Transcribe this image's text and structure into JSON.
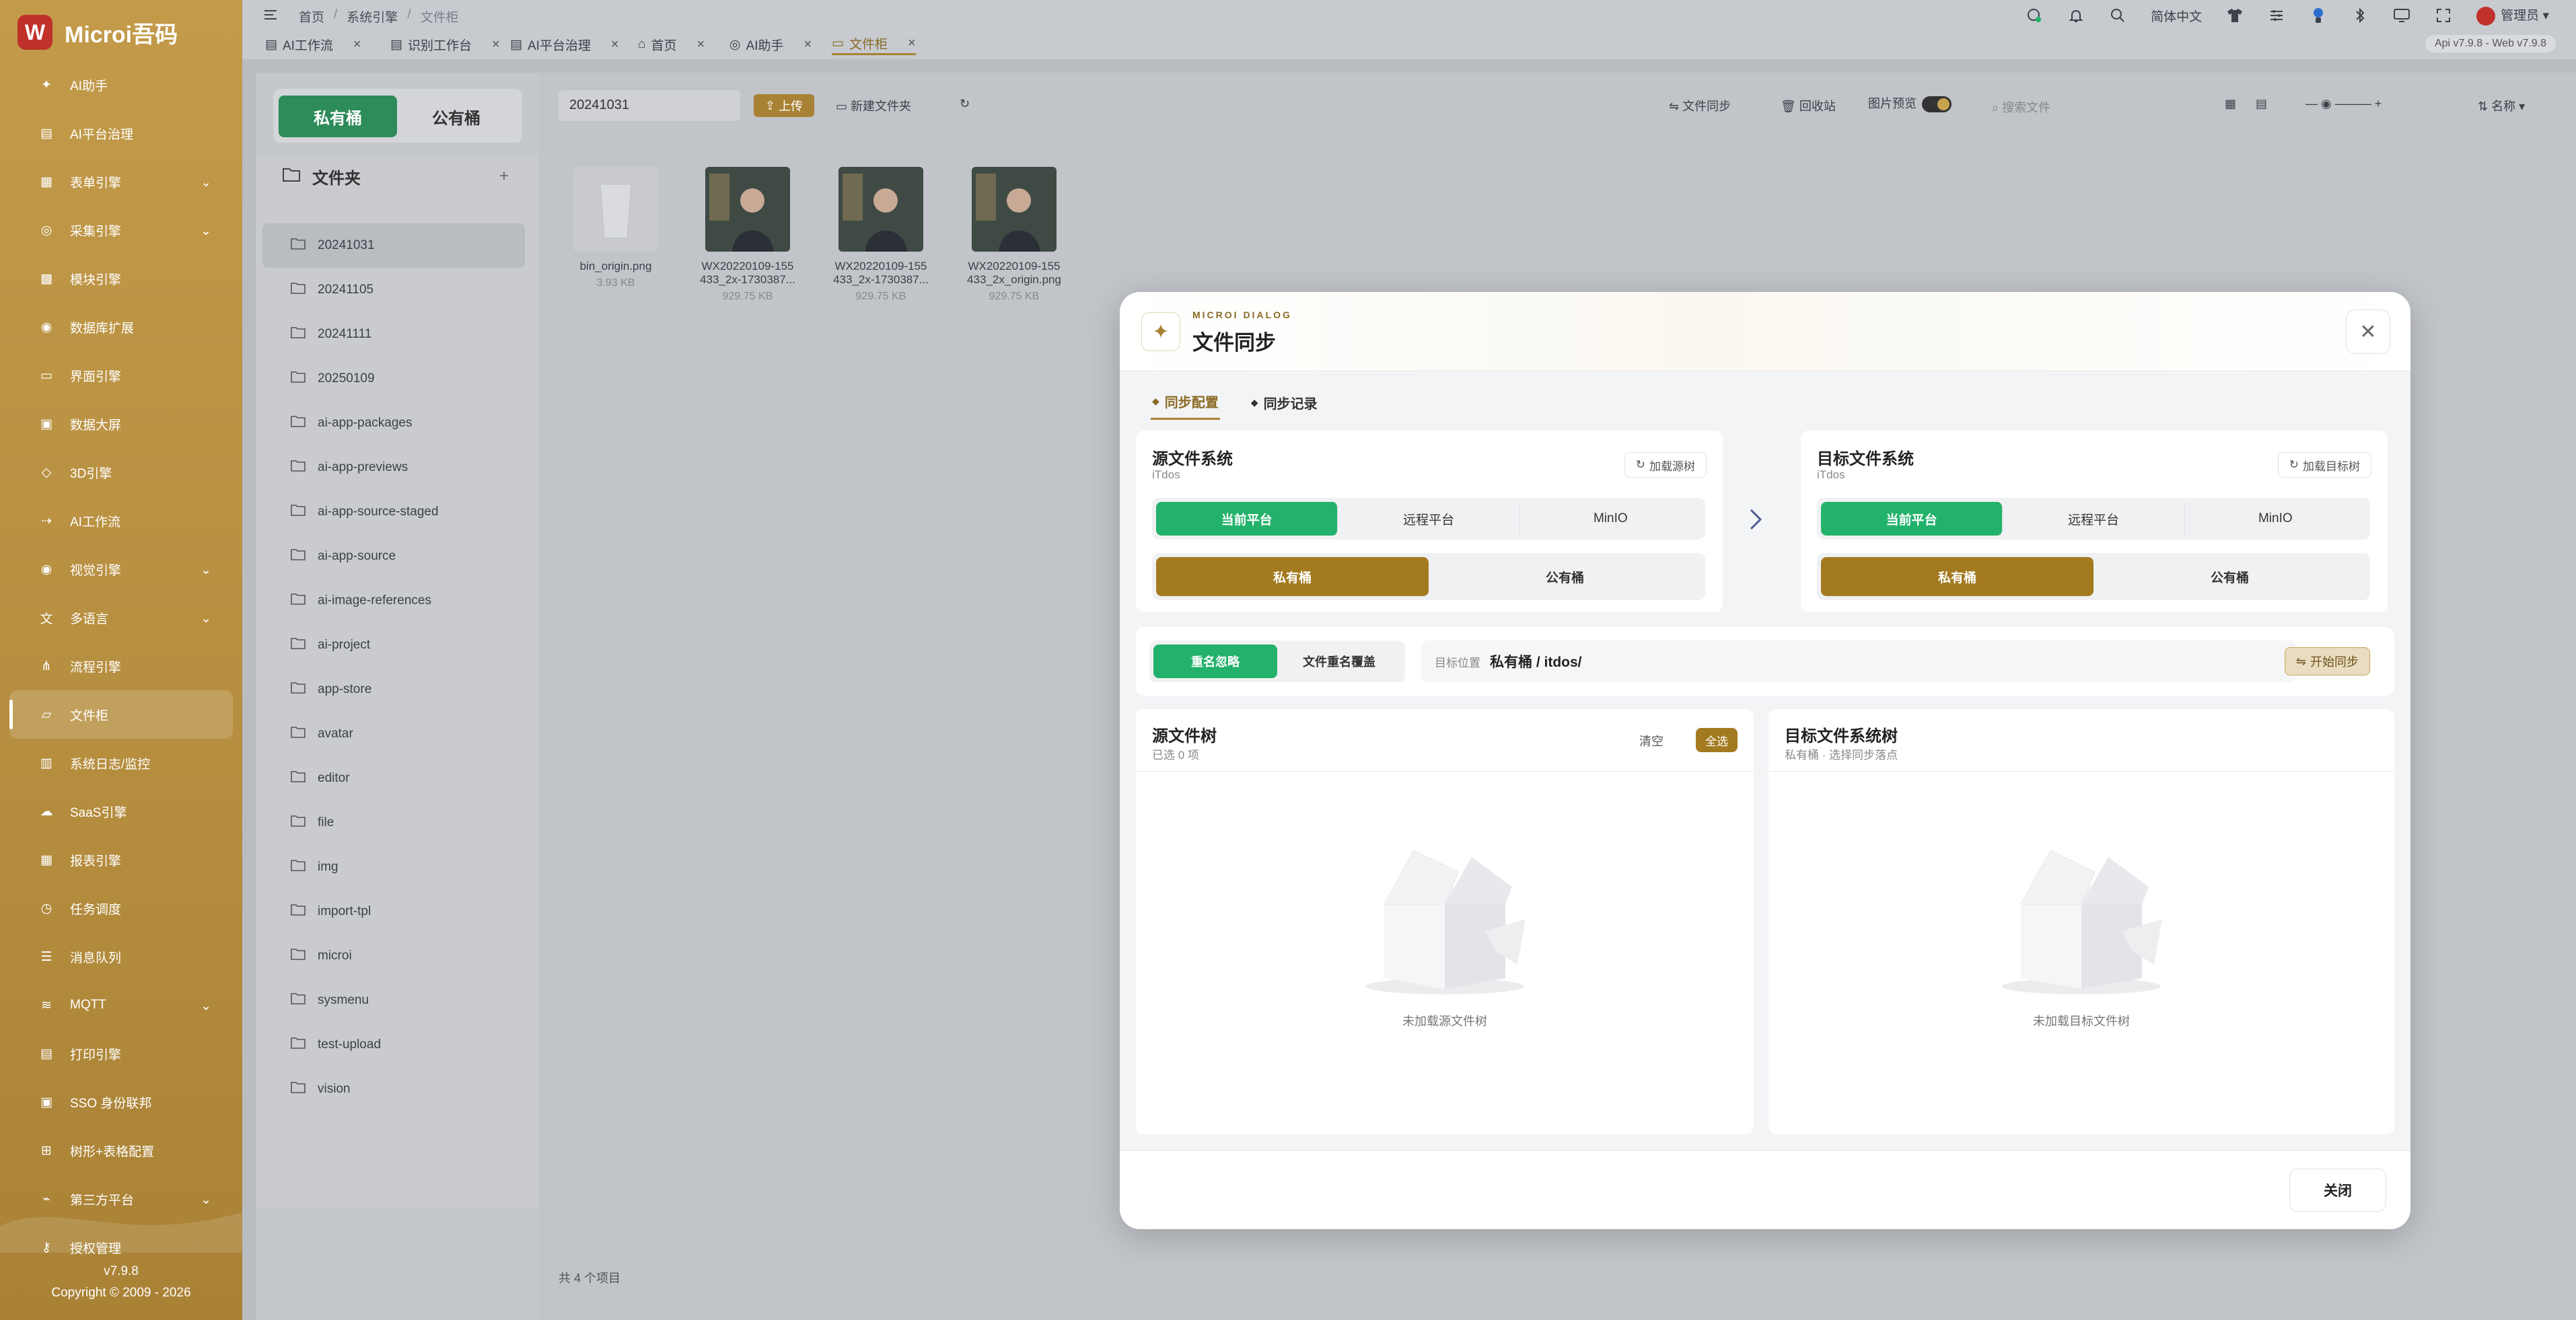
{
  "app": {
    "title": "Microi吾码",
    "logo_letter": "W"
  },
  "sidebar": {
    "items": [
      {
        "label": "AI助手",
        "icon": "sparkle-icon",
        "has_children": false
      },
      {
        "label": "AI平台治理",
        "icon": "database-icon",
        "has_children": false
      },
      {
        "label": "表单引擎",
        "icon": "form-icon",
        "has_children": true
      },
      {
        "label": "采集引擎",
        "icon": "globe-icon",
        "has_children": true
      },
      {
        "label": "模块引擎",
        "icon": "grid-icon",
        "has_children": false
      },
      {
        "label": "数据库扩展",
        "icon": "db-icon",
        "has_children": false
      },
      {
        "label": "界面引擎",
        "icon": "layout-icon",
        "has_children": false
      },
      {
        "label": "数据大屏",
        "icon": "monitor-icon",
        "has_children": false
      },
      {
        "label": "3D引擎",
        "icon": "cube-icon",
        "has_children": false
      },
      {
        "label": "AI工作流",
        "icon": "flow-icon",
        "has_children": false
      },
      {
        "label": "视觉引擎",
        "icon": "eye-icon",
        "has_children": true
      },
      {
        "label": "多语言",
        "icon": "language-icon",
        "has_children": true
      },
      {
        "label": "流程引擎",
        "icon": "share-icon",
        "has_children": false
      },
      {
        "label": "文件柜",
        "icon": "folder-icon",
        "has_children": false,
        "active": true
      },
      {
        "label": "系统日志/监控",
        "icon": "log-icon",
        "has_children": false
      },
      {
        "label": "SaaS引擎",
        "icon": "cloud-icon",
        "has_children": false
      },
      {
        "label": "报表引擎",
        "icon": "report-icon",
        "has_children": false
      },
      {
        "label": "任务调度",
        "icon": "clock-icon",
        "has_children": false
      },
      {
        "label": "消息队列",
        "icon": "queue-icon",
        "has_children": false
      },
      {
        "label": "MQTT",
        "icon": "wifi-icon",
        "has_children": true
      },
      {
        "label": "打印引擎",
        "icon": "printer-icon",
        "has_children": false
      },
      {
        "label": "SSO 身份联邦",
        "icon": "id-icon",
        "has_children": false
      },
      {
        "label": "树形+表格配置",
        "icon": "tree-icon",
        "has_children": false
      },
      {
        "label": "第三方平台",
        "icon": "plug-icon",
        "has_children": true
      },
      {
        "label": "授权管理",
        "icon": "key-icon",
        "has_children": false
      }
    ],
    "version": "v7.9.8",
    "copyright": "Copyright © 2009 - 2026"
  },
  "topbar": {
    "breadcrumb": [
      "首页",
      "系统引擎",
      "文件柜"
    ],
    "language": "简体中文",
    "user": "管理员",
    "version_badge": "Api v7.9.8 - Web v7.9.8"
  },
  "tabs": [
    {
      "label": "AI工作流",
      "active": false
    },
    {
      "label": "识别工作台",
      "active": false
    },
    {
      "label": "AI平台治理",
      "active": false
    },
    {
      "label": "首页",
      "active": false
    },
    {
      "label": "AI助手",
      "active": false
    },
    {
      "label": "文件柜",
      "active": true
    }
  ],
  "file_manager": {
    "bucket_private": "私有桶",
    "bucket_public": "公有桶",
    "folder_title": "文件夹",
    "folders": [
      "20241031",
      "20241105",
      "20241111",
      "20250109",
      "ai-app-packages",
      "ai-app-previews",
      "ai-app-source-staged",
      "ai-app-source",
      "ai-image-references",
      "ai-project",
      "app-store",
      "avatar",
      "editor",
      "file",
      "img",
      "import-tpl",
      "microi",
      "sysmenu",
      "test-upload",
      "vision"
    ],
    "selected_folder": "20241031",
    "path_value": "20241031",
    "upload": "上传",
    "new_folder": "新建文件夹",
    "file_sync": "文件同步",
    "recycle_bin": "回收站",
    "image_preview": "图片预览",
    "search_placeholder": "搜索文件",
    "sort": "名称",
    "files": [
      {
        "name1": "bin_origin.png",
        "name2": "",
        "size": "3.93 KB"
      },
      {
        "name1": "WX20220109-155",
        "name2": "433_2x-1730387...",
        "size": "929.75 KB"
      },
      {
        "name1": "WX20220109-155",
        "name2": "433_2x-1730387...",
        "size": "929.75 KB"
      },
      {
        "name1": "WX20220109-155",
        "name2": "433_2x_origin.png",
        "size": "929.75 KB"
      }
    ],
    "status": "共 4 个项目"
  },
  "dialog": {
    "eyebrow": "MICROI DIALOG",
    "title": "文件同步",
    "tabs": [
      {
        "label": "同步配置",
        "active": true
      },
      {
        "label": "同步记录",
        "active": false
      }
    ],
    "source": {
      "title": "源文件系统",
      "sub": "iTdos",
      "load": "加载源树",
      "platforms": [
        "当前平台",
        "远程平台",
        "MinIO"
      ],
      "platform_selected": 0,
      "buckets": [
        "私有桶",
        "公有桶"
      ],
      "bucket_selected": 0
    },
    "target": {
      "title": "目标文件系统",
      "sub": "iTdos",
      "load": "加载目标树",
      "platforms": [
        "当前平台",
        "远程平台",
        "MinIO"
      ],
      "platform_selected": 0,
      "buckets": [
        "私有桶",
        "公有桶"
      ],
      "bucket_selected": 0
    },
    "strategy": [
      "重名忽略",
      "文件重名覆盖"
    ],
    "strategy_selected": 0,
    "target_location_label": "目标位置",
    "target_location_value": "私有桶 / itdos/",
    "start_sync": "开始同步",
    "source_tree": {
      "title": "源文件树",
      "sub": "已选 0 项",
      "clear": "清空",
      "select_all": "全选",
      "empty": "未加载源文件树"
    },
    "target_tree": {
      "title": "目标文件系统树",
      "sub": "私有桶 · 选择同步落点",
      "empty": "未加载目标文件树"
    },
    "close": "关闭"
  },
  "colors": {
    "green": "#23b26b",
    "gold": "#a37a20",
    "sidebar": "#b58d3e"
  }
}
